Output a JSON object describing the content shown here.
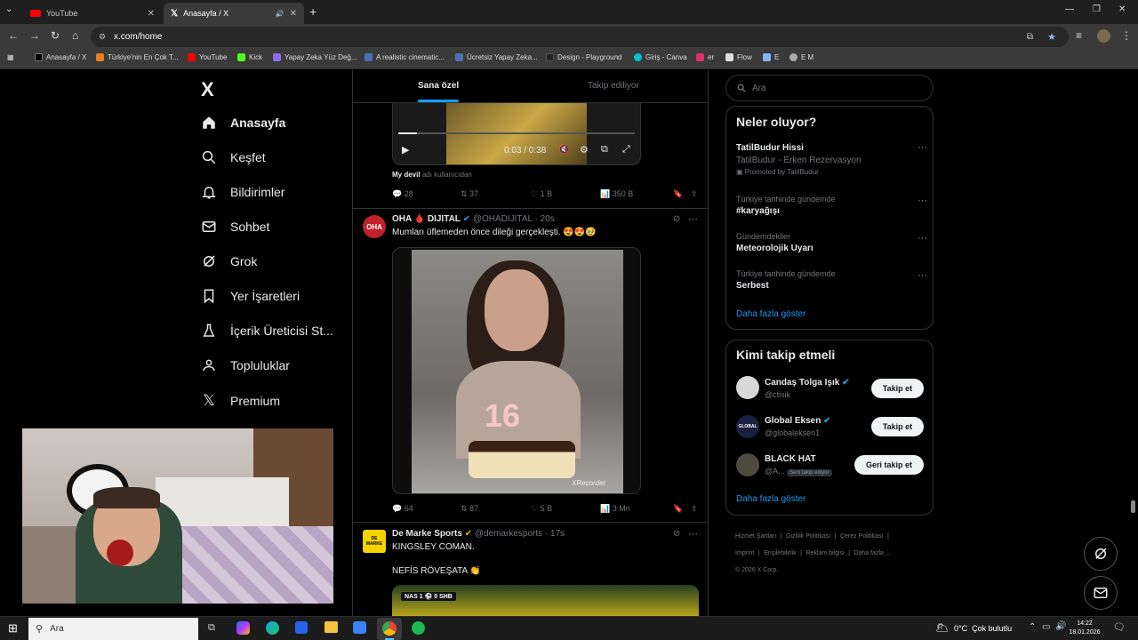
{
  "browser": {
    "tabs": [
      {
        "label": "YouTube"
      },
      {
        "label": "Anasayfa / X"
      }
    ],
    "url": "x.com/home",
    "bookmarks": [
      "Anasayfa / X",
      "Türkiye'nin En Çok T...",
      "YouTube",
      "Kick",
      "Yapay Zeka Yüz Değ...",
      "A realistic cinematic...",
      "Ücretsiz Yapay Zeka...",
      "Design - Playground",
      "Giriş - Canva",
      "er",
      "Flow",
      "E",
      "E M"
    ]
  },
  "sidebar": {
    "logo": "X",
    "items": [
      {
        "label": "Anasayfa",
        "icon": "home-icon"
      },
      {
        "label": "Keşfet",
        "icon": "search-icon"
      },
      {
        "label": "Bildirimler",
        "icon": "bell-icon"
      },
      {
        "label": "Sohbet",
        "icon": "mail-icon"
      },
      {
        "label": "Grok",
        "icon": "grok-icon"
      },
      {
        "label": "Yer İşaretleri",
        "icon": "bookmark-icon"
      },
      {
        "label": "İçerik Üreticisi St...",
        "icon": "creator-icon"
      },
      {
        "label": "Topluluklar",
        "icon": "communities-icon"
      },
      {
        "label": "Premium",
        "icon": "x-icon"
      }
    ]
  },
  "feed": {
    "tabs": [
      "Sana özel",
      "Takip ediliyor"
    ],
    "video_time": "0:03 / 0:38",
    "prev_tweet": {
      "caption_bold": "My devil",
      "caption_rest": "adı kullanıcıdan",
      "replies": "28",
      "retweets": "37",
      "likes": "1 B",
      "views": "350 B"
    },
    "tweet1": {
      "avatar": "OHA",
      "name": "OHA 🩸 DIJITAL",
      "handle": "@OHADIJITAL · 20s",
      "text": "Mumları üflemeden önce dileği gerçekleşti. 😍😍🥹",
      "watermark": "XRecorder",
      "cake_number": "16",
      "replies": "64",
      "retweets": "87",
      "likes": "5 B",
      "views": "3 Mn"
    },
    "tweet2": {
      "avatar": "DE MARKE",
      "name": "De Marke Sports",
      "handle": "@demarkesports · 17s",
      "line1": "KINGSLEY COMAN.",
      "line2": "NEFİS RÖVEŞATA 👏",
      "score": "NAS 1 ⚽ 0 SHB"
    }
  },
  "right": {
    "search_placeholder": "Ara",
    "trends_title": "Neler oluyor?",
    "trends": [
      {
        "sub": "",
        "title": "TatilBudur Hissi",
        "desc": "TatilBudur - Erken Rezervasyon",
        "promo": "Promoted by TatilBudur"
      },
      {
        "sub": "Türkiye tarihinde gündemde",
        "title": "#karyağışı"
      },
      {
        "sub": "Gündemdekiler",
        "title": "Meteorolojik Uyarı"
      },
      {
        "sub": "Türkiye tarihinde gündemde",
        "title": "Serbest"
      }
    ],
    "show_more": "Daha fazla göster",
    "who_title": "Kimi takip etmeli",
    "who": [
      {
        "name": "Candaş Tolga Işık",
        "handle": "@ctisik",
        "button": "Takip et"
      },
      {
        "name": "Global Eksen",
        "handle": "@globaleksen1",
        "button": "Takip et",
        "avatar": "GLOBAL"
      },
      {
        "name": "BLACK HAT",
        "handle": "@A...",
        "badge": "Seni takip ediyor",
        "button": "Geri takip et"
      }
    ],
    "who_more": "Daha fazla göster",
    "footer": [
      "Hizmet Şartları",
      "|",
      "Gizlilik Politikası",
      "|",
      "Çerez Politikası",
      "|",
      "Imprint",
      "|",
      "Erişilebilirlik",
      "|",
      "Reklam bilgisi",
      "|",
      "Daha fazla ...",
      "© 2026 X Corp."
    ]
  },
  "taskbar": {
    "search": "Ara",
    "weather": "0°C  Çok bulutlu",
    "time": "14:22",
    "date": "18.01.2026"
  },
  "colors": {
    "accent": "#1d9bf0",
    "bg": "#000000"
  }
}
